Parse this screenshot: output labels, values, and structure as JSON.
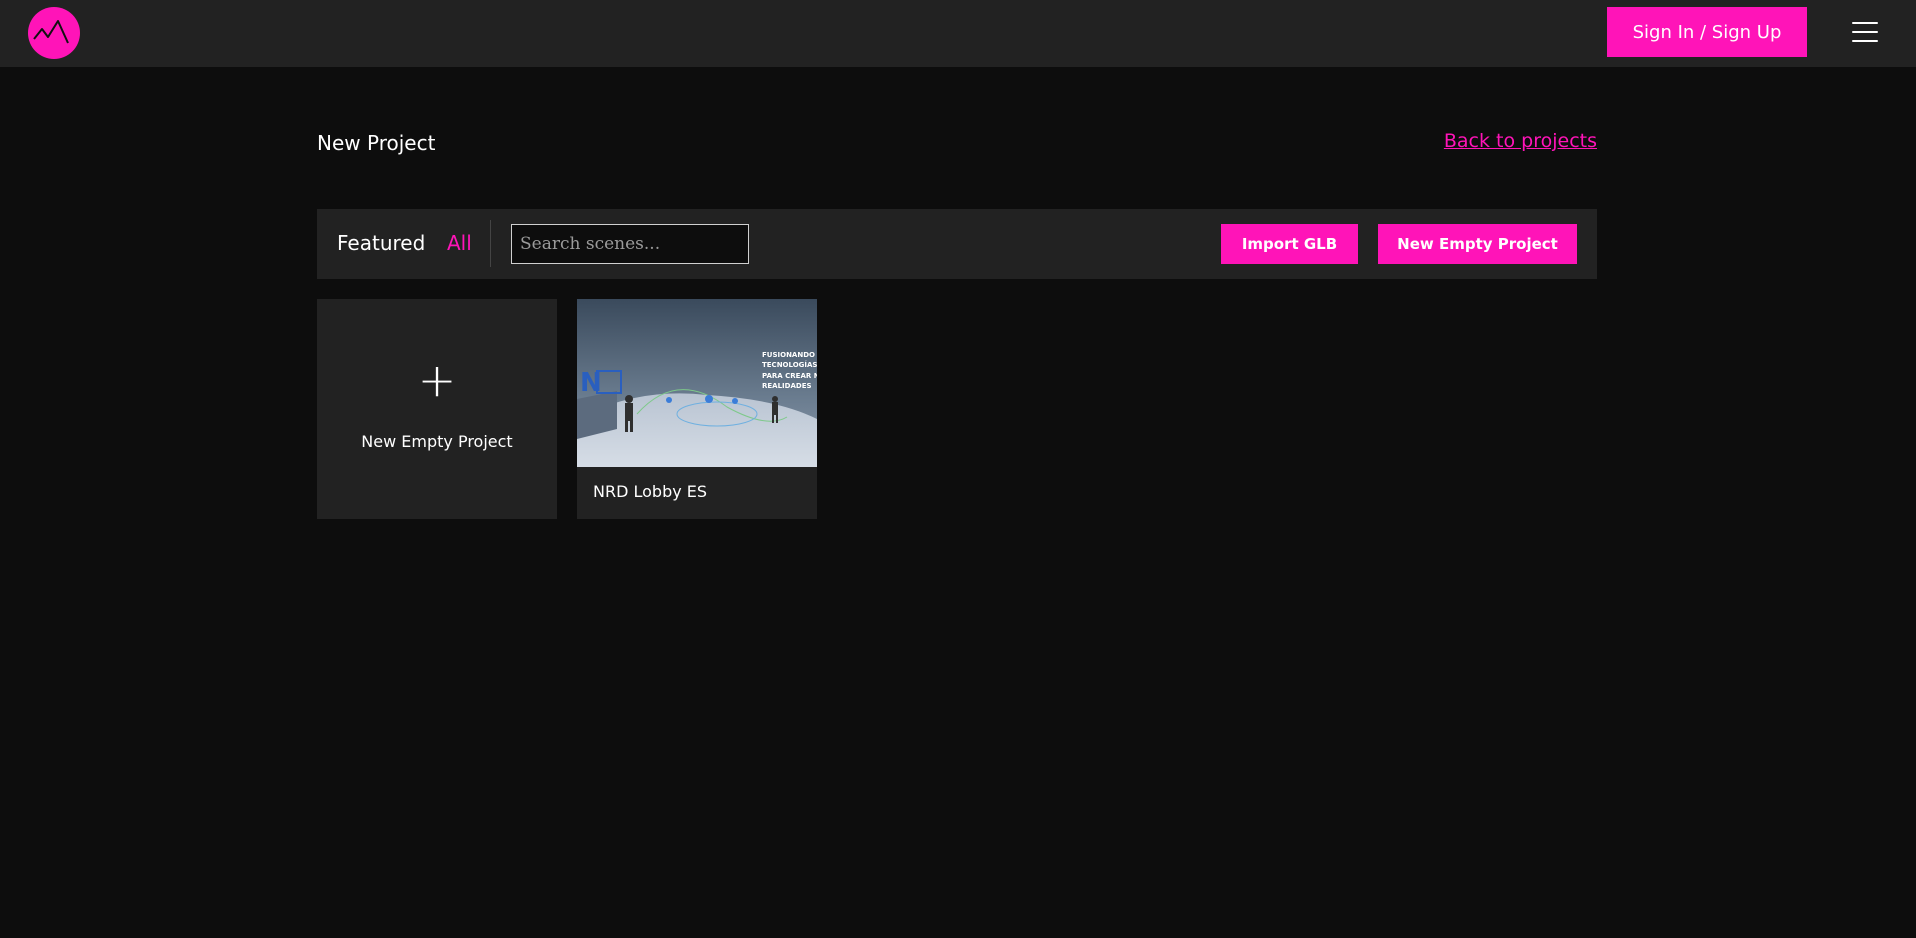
{
  "header": {
    "logo_icon": "mountain-peaks-icon",
    "signin_label": "Sign In / Sign Up",
    "menu_icon": "hamburger-menu-icon",
    "accent_color": "#ff14b8"
  },
  "page": {
    "title": "New Project",
    "back_link": "Back to projects"
  },
  "toolbar": {
    "tabs": [
      {
        "label": "Featured",
        "active": false
      },
      {
        "label": "All",
        "active": true
      }
    ],
    "search": {
      "placeholder": "Search scenes...",
      "value": ""
    },
    "import_label": "Import GLB",
    "new_label": "New Empty Project"
  },
  "cards": [
    {
      "type": "new",
      "icon": "plus-icon",
      "label": "New Empty Project"
    },
    {
      "type": "scene",
      "label": "NRD Lobby ES",
      "thumb_text": [
        "FUSIONANDO",
        "TECNOLOGÍAS",
        "PARA CREAR N",
        "REALIDADES"
      ]
    }
  ]
}
